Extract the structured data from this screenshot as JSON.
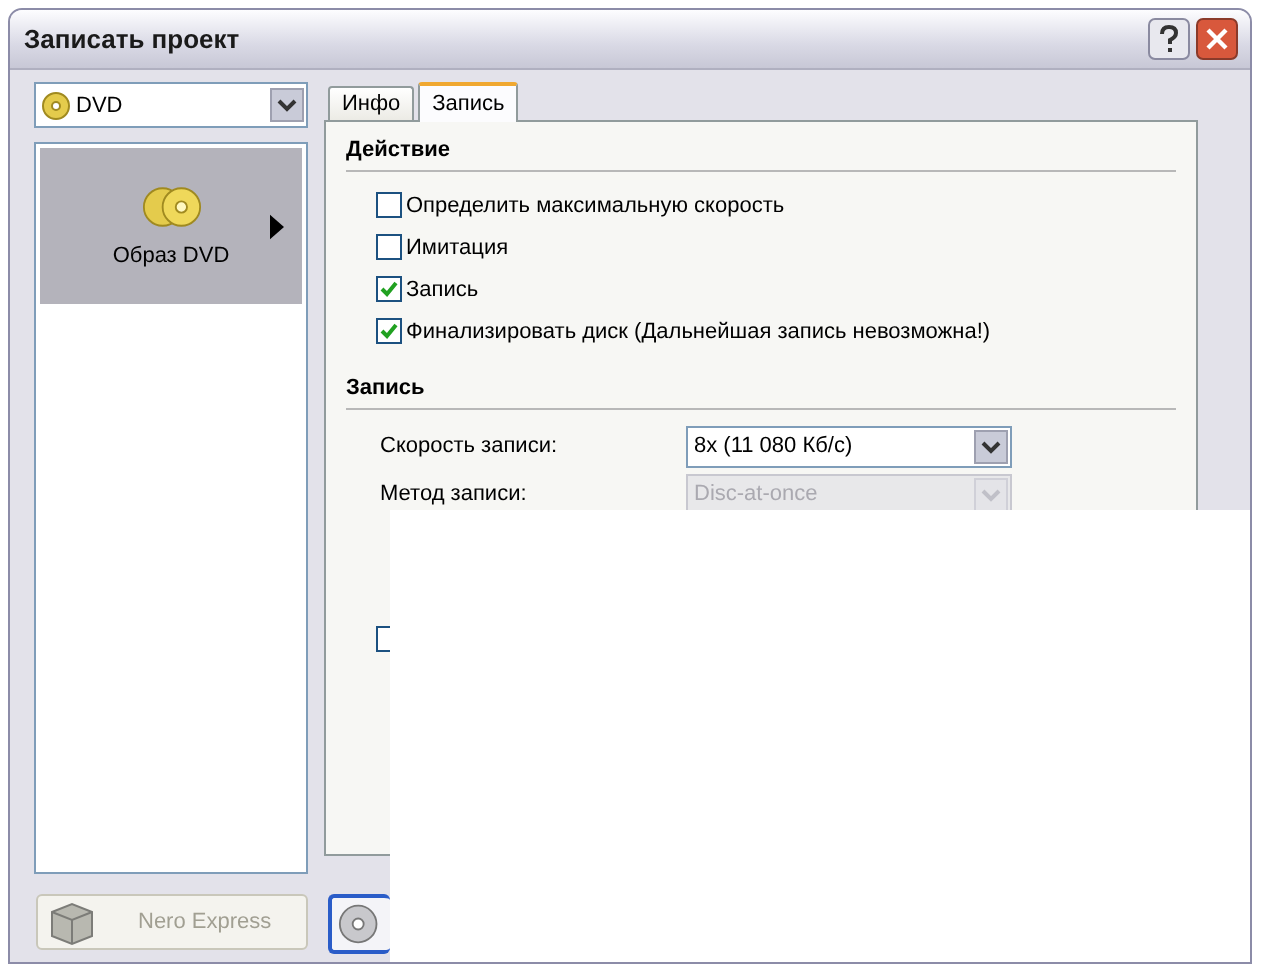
{
  "window": {
    "title": "Записать проект"
  },
  "device_select": {
    "value": "DVD"
  },
  "sidebar": {
    "items": [
      {
        "label": "Образ DVD",
        "selected": true
      }
    ]
  },
  "tabs": [
    {
      "label": "Инфо",
      "selected": false
    },
    {
      "label": "Запись",
      "selected": true
    }
  ],
  "sections": [
    {
      "title": "Действие",
      "options": [
        {
          "label": "Определить максимальную скорость",
          "checked": false
        },
        {
          "label": "Имитация",
          "checked": false
        },
        {
          "label": "Запись",
          "checked": true
        },
        {
          "label": "Финализировать диск (Дальнейшая запись невозможна!)",
          "checked": true
        }
      ]
    },
    {
      "title": "Запись",
      "fields": [
        {
          "label": "Скорость записи:",
          "value": "8x (11 080 Кб/с)",
          "disabled": false
        },
        {
          "label": "Метод записи:",
          "value": "Disc-at-once",
          "disabled": true
        }
      ],
      "lower_options": [
        {
          "checked": false
        }
      ]
    }
  ],
  "buttons": [
    {
      "label": "Nero Express",
      "disabled": true
    }
  ]
}
